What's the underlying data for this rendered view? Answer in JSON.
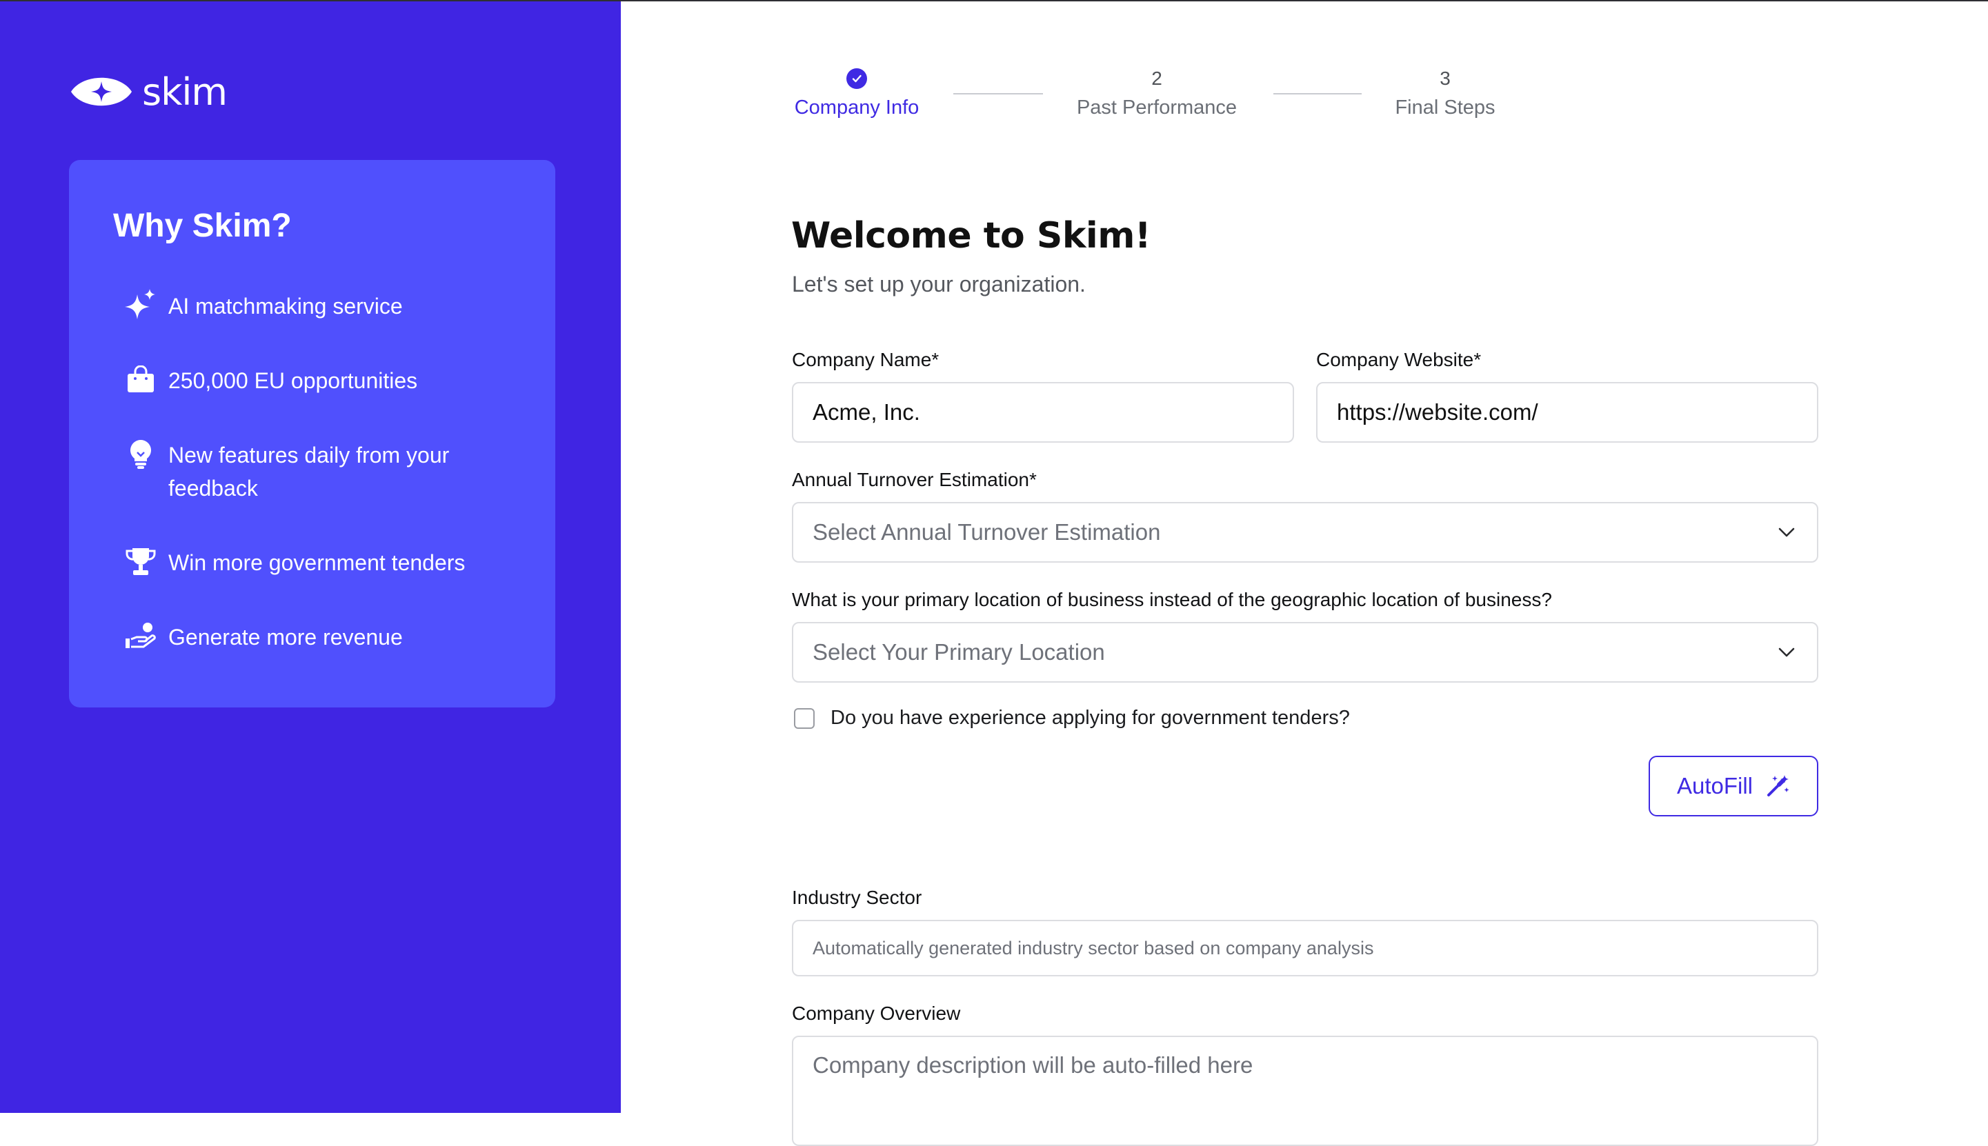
{
  "brand": {
    "name": "skim"
  },
  "sidebar": {
    "card_title": "Why Skim?",
    "benefits": [
      {
        "icon": "sparkles-icon",
        "text": "AI matchmaking service"
      },
      {
        "icon": "shopping-bag-icon",
        "text": "250,000 EU opportunities"
      },
      {
        "icon": "lightbulb-icon",
        "text": "New features daily from your feedback"
      },
      {
        "icon": "trophy-icon",
        "text": "Win more government tenders"
      },
      {
        "icon": "hand-coin-icon",
        "text": "Generate more revenue"
      }
    ]
  },
  "stepper": {
    "steps": [
      {
        "marker": "",
        "label": "Company Info",
        "state": "completed"
      },
      {
        "marker": "2",
        "label": "Past Performance",
        "state": "upcoming"
      },
      {
        "marker": "3",
        "label": "Final Steps",
        "state": "upcoming"
      }
    ]
  },
  "form": {
    "title": "Welcome to Skim!",
    "subtitle": "Let's set up your organization.",
    "company_name": {
      "label": "Company Name*",
      "value": "Acme, Inc."
    },
    "company_website": {
      "label": "Company Website*",
      "value": "https://website.com/"
    },
    "turnover": {
      "label": "Annual Turnover Estimation*",
      "placeholder": "Select Annual Turnover Estimation"
    },
    "location": {
      "label": "What is your primary location of business instead of the geographic location of business?",
      "placeholder": "Select Your Primary Location"
    },
    "experience": {
      "label": "Do you have experience applying for government tenders?",
      "checked": false
    },
    "autofill_label": "AutoFill",
    "industry": {
      "label": "Industry Sector",
      "placeholder": "Automatically generated industry sector based on company analysis"
    },
    "overview": {
      "label": "Company Overview",
      "placeholder": "Company description will be auto-filled here"
    }
  },
  "colors": {
    "sidebar_bg": "#4025e3",
    "card_bg": "#5050fd",
    "accent": "#3f2ae3"
  }
}
